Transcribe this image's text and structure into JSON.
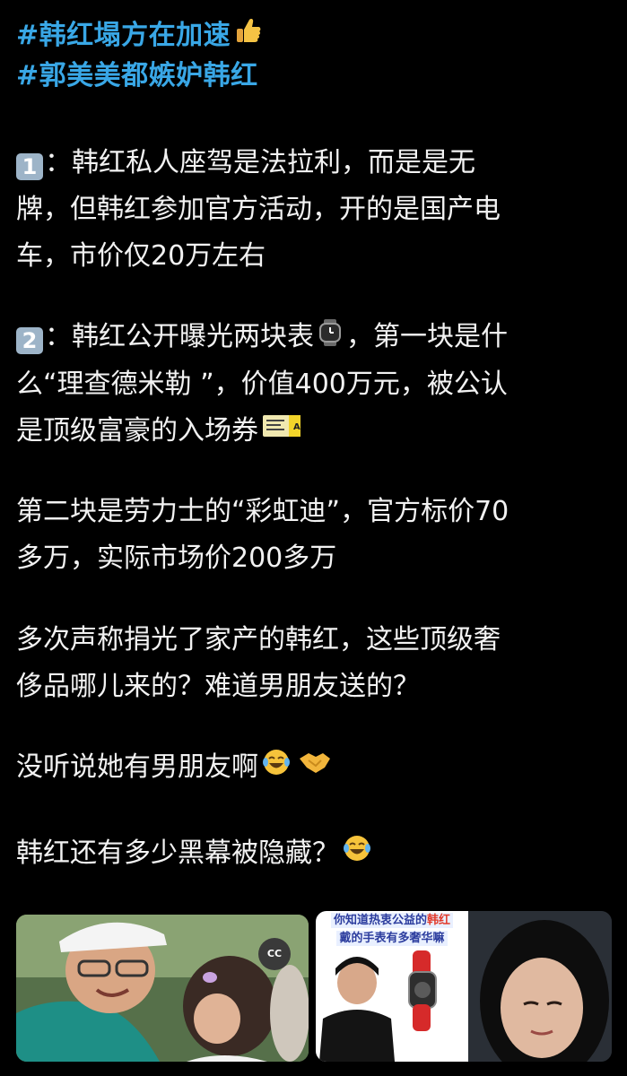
{
  "post": {
    "hashtags": [
      "#韩红塌方在加速",
      "#郭美美都嫉妒韩红"
    ],
    "para1": {
      "badge": "1",
      "lines": [
        "：韩红私人座驾是法拉利，而是是无",
        "牌，但韩红参加官方活动，开的是国产电",
        "车，市价仅20万左右"
      ]
    },
    "para2": {
      "badge": "2",
      "lines": [
        "：韩红公开曝光两块表",
        "，第一块是什",
        "么“理查德米勒 ”，价值400万元，被公认",
        "是顶级富豪的入场券"
      ]
    },
    "para3": {
      "lines": [
        "第二块是劳力士的“彩虹迪”，官方标价70",
        "多万，实际市场价200多万"
      ]
    },
    "para4": {
      "lines": [
        "多次声称捐光了家产的韩红，这些顶级奢",
        "侈品哪儿来的？难道男朋友送的？"
      ]
    },
    "para5": {
      "text": "没听说她有男朋友啊"
    },
    "para6": {
      "text": "韩红还有多少黑幕被隐藏？"
    },
    "media": {
      "left_cc": "CC",
      "right_caption_line1a": "你知道热衷公益的",
      "right_caption_line1b": "韩红",
      "right_caption_line2": "戴的手表有多奢华嘛"
    },
    "colors": {
      "background": "#000000",
      "hashtag": "#39a7e6",
      "text": "#f2f2f2",
      "badge": "#9db4c8"
    },
    "icons": [
      "thumbs-up-icon",
      "watch-icon",
      "ticket-icon",
      "tears-of-joy-icon",
      "handshake-icon"
    ]
  }
}
